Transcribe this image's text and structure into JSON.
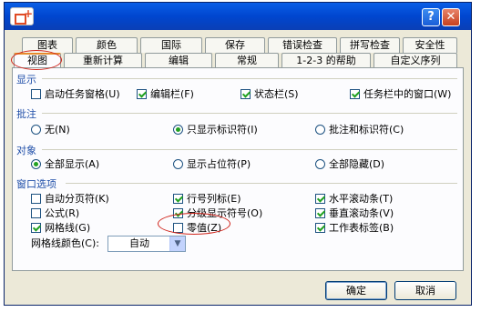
{
  "title_buttons": {
    "help": "?",
    "close": "✕"
  },
  "tabs_row1": [
    "图表",
    "颜色",
    "国际",
    "保存",
    "错误检查",
    "拼写检查",
    "安全性"
  ],
  "tabs_row2": [
    "视图",
    "重新计算",
    "编辑",
    "常规",
    "1-2-3 的帮助",
    "自定义序列"
  ],
  "sections": {
    "display": "显示",
    "comments": "批注",
    "objects": "对象",
    "window_options": "窗口选项"
  },
  "display_options": [
    {
      "label": "启动任务窗格",
      "key": "(U)",
      "checked": false
    },
    {
      "label": "编辑栏",
      "key": "(F)",
      "checked": true
    },
    {
      "label": "状态栏",
      "key": "(S)",
      "checked": true
    },
    {
      "label": "任务栏中的窗口",
      "key": "(W)",
      "checked": true
    }
  ],
  "comment_options": [
    {
      "label": "无",
      "key": "(N)",
      "checked": false
    },
    {
      "label": "只显示标识符",
      "key": "(I)",
      "checked": true
    },
    {
      "label": "批注和标识符",
      "key": "(C)",
      "checked": false
    }
  ],
  "object_options": [
    {
      "label": "全部显示",
      "key": "(A)",
      "checked": true
    },
    {
      "label": "显示占位符",
      "key": "(P)",
      "checked": false
    },
    {
      "label": "全部隐藏",
      "key": "(D)",
      "checked": false
    }
  ],
  "window_options": [
    {
      "label": "自动分页符",
      "key": "(K)",
      "checked": false
    },
    {
      "label": "行号列标",
      "key": "(E)",
      "checked": true
    },
    {
      "label": "水平滚动条",
      "key": "(T)",
      "checked": true
    },
    {
      "label": "公式",
      "key": "(R)",
      "checked": false
    },
    {
      "label": "分级显示符号",
      "key": "(O)",
      "checked": true
    },
    {
      "label": "垂直滚动条",
      "key": "(V)",
      "checked": true
    },
    {
      "label": "网格线",
      "key": "(G)",
      "checked": true
    },
    {
      "label": "零值",
      "key": "(Z)",
      "checked": false
    },
    {
      "label": "工作表标签",
      "key": "(B)",
      "checked": true
    }
  ],
  "gridline_color": {
    "label": "网格线颜色",
    "key": "(C):",
    "value": "自动"
  },
  "buttons": {
    "ok": "确定",
    "cancel": "取消"
  },
  "colors": {
    "title_bar": "#0a5ee6",
    "dialog_bg": "#ece9d8",
    "annotation": "#d0241b",
    "check": "#21a121"
  }
}
